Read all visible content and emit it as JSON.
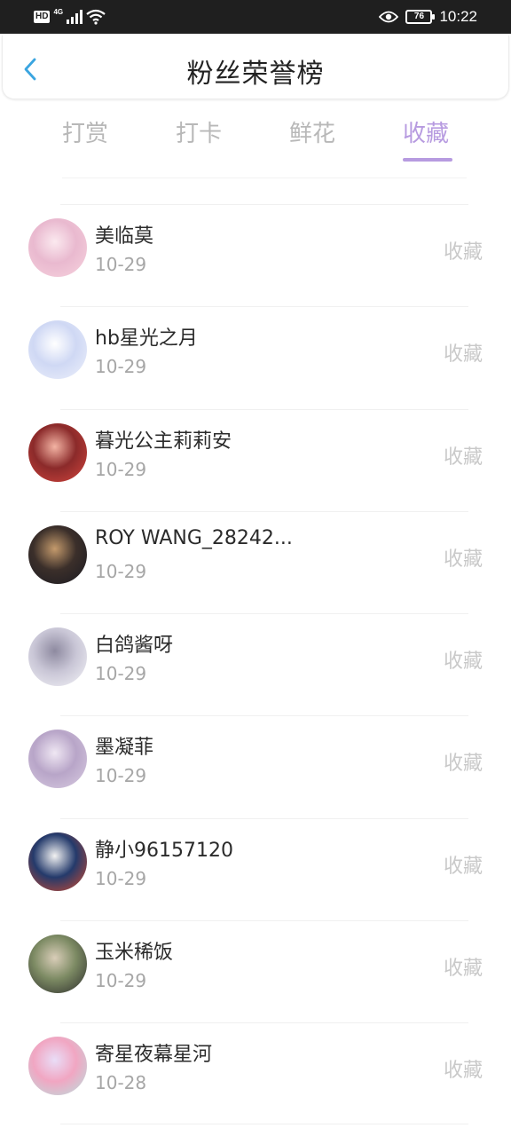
{
  "status_bar": {
    "hd_label": "HD",
    "network_label": "4G",
    "battery_level": "76",
    "time": "10:22"
  },
  "header": {
    "back_icon": "chevron-left-icon",
    "title": "粉丝荣誉榜"
  },
  "tabs": [
    {
      "label": "打赏",
      "active": false
    },
    {
      "label": "打卡",
      "active": false
    },
    {
      "label": "鲜花",
      "active": false
    },
    {
      "label": "收藏",
      "active": true
    }
  ],
  "colors": {
    "accent": "#b79be0",
    "tab_inactive": "#b8b8b8",
    "action_text": "#c9c9c9"
  },
  "fans": [
    {
      "name": "美临莫",
      "date": "10-29",
      "action": "收藏",
      "avatar_colors": [
        "#f7d3de",
        "#e9b9cf",
        "#fbe9ef"
      ]
    },
    {
      "name": "hb星光之月",
      "date": "10-29",
      "action": "收藏",
      "avatar_colors": [
        "#eef1fb",
        "#cfd8f4",
        "#ffffff"
      ]
    },
    {
      "name": "暮光公主莉莉安",
      "date": "10-29",
      "action": "收藏",
      "avatar_colors": [
        "#d5463e",
        "#8b2a2a",
        "#f3b3a3"
      ]
    },
    {
      "name": "ROY WANG_28242...",
      "date": "10-29",
      "action": "收藏",
      "avatar_colors": [
        "#1a1a22",
        "#3b2f2a",
        "#c49a6c"
      ]
    },
    {
      "name": "白鸽酱呀",
      "date": "10-29",
      "action": "收藏",
      "avatar_colors": [
        "#f4f4f8",
        "#c9c6d6",
        "#8e8aa0"
      ]
    },
    {
      "name": "墨凝菲",
      "date": "10-29",
      "action": "收藏",
      "avatar_colors": [
        "#d9cde2",
        "#b8a5c8",
        "#efe7f3"
      ]
    },
    {
      "name": "静小96157120",
      "date": "10-29",
      "action": "收藏",
      "avatar_colors": [
        "#d94a2b",
        "#243a6b",
        "#f2f2f2"
      ]
    },
    {
      "name": "玉米稀饭",
      "date": "10-29",
      "action": "收藏",
      "avatar_colors": [
        "#2a2a2a",
        "#7c8a63",
        "#d9cdb8"
      ]
    },
    {
      "name": "寄星夜幕星河",
      "date": "10-28",
      "action": "收藏",
      "avatar_colors": [
        "#b6e3e0",
        "#f1a6c2",
        "#e9ddf7"
      ]
    }
  ]
}
